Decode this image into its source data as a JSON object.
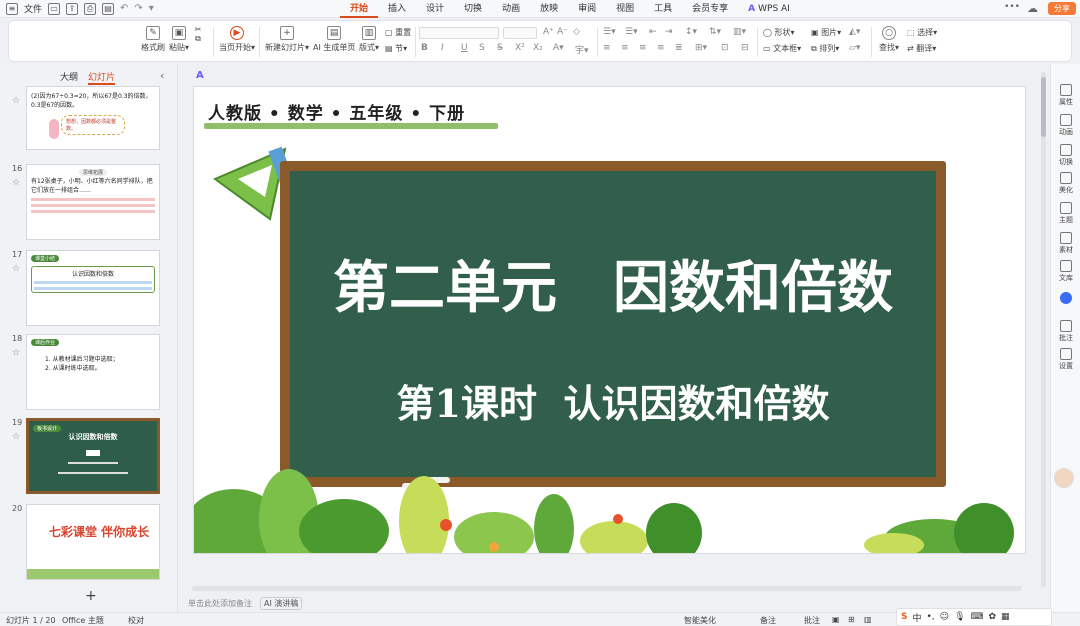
{
  "topbar": {
    "file_label": "文件",
    "menus": [
      "开始",
      "插入",
      "设计",
      "切换",
      "动画",
      "放映",
      "审阅",
      "视图",
      "工具",
      "会员专享"
    ],
    "active_menu": "开始",
    "wps_ai": "WPS AI",
    "share": "分享"
  },
  "ribbon": {
    "format_painter": "格式刷",
    "paste": "粘贴",
    "from_current": "当页开始",
    "new_slide": "新建幻灯片",
    "ai_generate": "AI 生成单页",
    "layout": "版式",
    "reset": "重置",
    "section": "节",
    "shape": "形状",
    "picture": "图片",
    "textbox": "文本框",
    "arrange": "排列",
    "find": "查找",
    "select": "选择",
    "replace": "翻译"
  },
  "leftpanel": {
    "tab_outline": "大纲",
    "tab_slides": "幻灯片",
    "slides": [
      {
        "num": "",
        "text": "(2)因为67÷0.3=20，所以67是0.3的倍数，0.3是67的因数。",
        "bubble": "想想，因数都必须是整数。"
      },
      {
        "num": "16",
        "text": "有12张桌子，小明、小红等六名同学排队，把它们放在一排组合……",
        "tag": "思维拓展"
      },
      {
        "num": "17",
        "text": "认识因数和倍数",
        "tag": "课堂小结"
      },
      {
        "num": "18",
        "text": "1. 从教材课后习题中选取； 2. 从课时练中选取。",
        "tag": "课后作业"
      },
      {
        "num": "19",
        "text": "认识因数和倍数",
        "tag": "板书设计"
      },
      {
        "num": "20",
        "text": "七彩课堂 伴你成长"
      }
    ]
  },
  "slide": {
    "subject": "人教版 • 数学 • 五年级 • 下册",
    "title1": "第二单元　因数和倍数",
    "title2": "第1课时  认识因数和倍数"
  },
  "rightbar": [
    "属性",
    "动画",
    "切换",
    "美化",
    "主题",
    "素材",
    "文库",
    "批注",
    "设置"
  ],
  "notes": {
    "placeholder": "单击此处添加备注",
    "ai_speech": "AI 演讲稿"
  },
  "statusbar": {
    "slide_pos": "幻灯片 1 / 20",
    "theme": "Office 主题",
    "proof": "校对",
    "smart": "智能美化",
    "notes": "备注",
    "comment": "批注"
  },
  "ime": {
    "lang": "中"
  },
  "colors": {
    "accent": "#d84c1e",
    "board": "#325f4c",
    "frame": "#8b5a2b",
    "share": "#f47a35"
  }
}
